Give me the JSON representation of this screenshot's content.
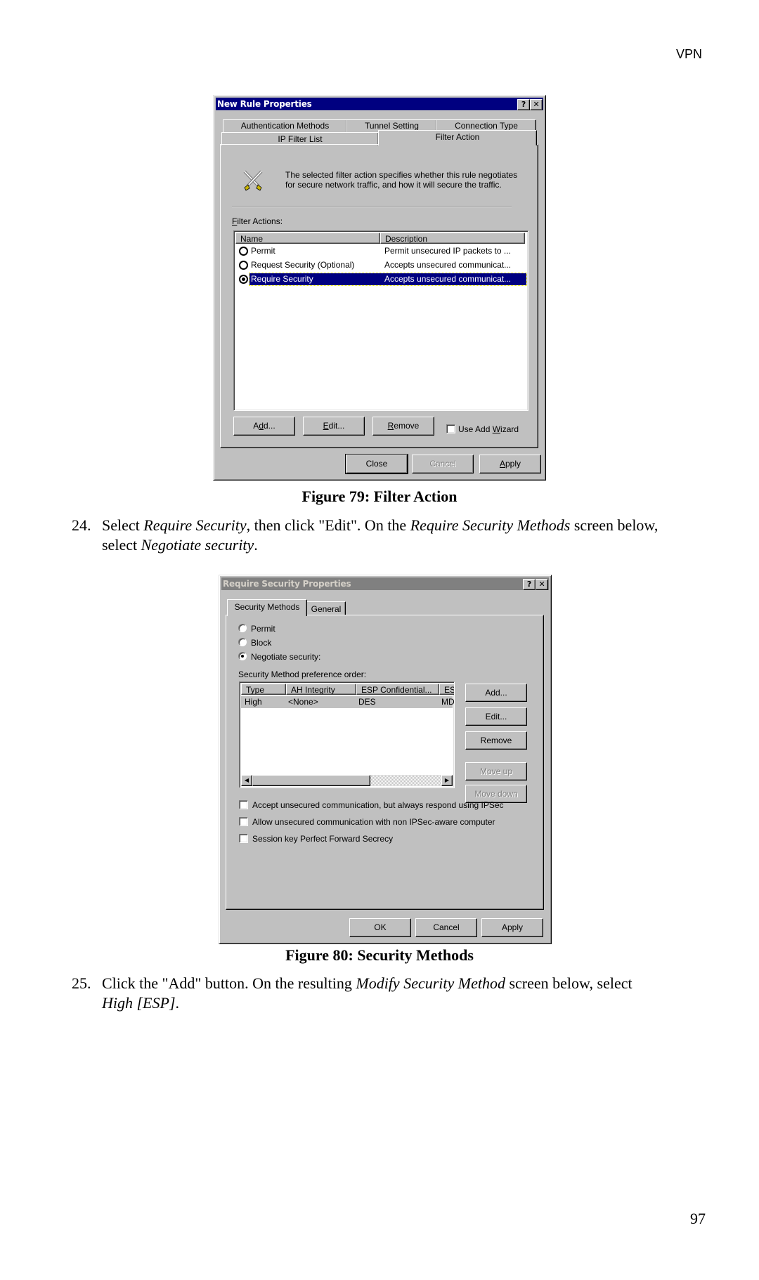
{
  "page": {
    "header": "VPN",
    "page_number": "97"
  },
  "figure79": {
    "caption": "Figure 79: Filter Action",
    "dialog": {
      "title": "New Rule Properties",
      "help_button": "?",
      "close_button": "✕",
      "tabs_back_row": [
        "Authentication Methods",
        "Tunnel Setting",
        "Connection Type"
      ],
      "tabs_front_row": [
        "IP Filter List",
        "Filter Action"
      ],
      "active_tab": "Filter Action",
      "description_line1": "The selected filter action specifies whether this rule negotiates",
      "description_line2": "for secure network traffic, and how it will secure the traffic.",
      "icon": "crossed-swords-icon",
      "list_label": "Filter Actions:",
      "columns": [
        "Name",
        "Description"
      ],
      "rows": [
        {
          "name": "Permit",
          "description": "Permit unsecured IP packets to ...",
          "selected": false
        },
        {
          "name": "Request Security (Optional)",
          "description": "Accepts unsecured communicat...",
          "selected": false
        },
        {
          "name": "Require Security",
          "description": "Accepts unsecured communicat...",
          "selected": true
        }
      ],
      "buttons": {
        "add": "Add...",
        "edit": "Edit...",
        "remove": "Remove"
      },
      "use_add_wizard": {
        "label": "Use Add Wizard",
        "checked": false
      },
      "footer": {
        "close": "Close",
        "cancel": "Cancel",
        "apply": "Apply"
      }
    }
  },
  "step24": {
    "number": "24.",
    "t1": "Select ",
    "i1": "Require Security",
    "t2": ", then click \"Edit\". On the ",
    "i2": "Require Security Methods",
    "t3": " screen below,",
    "t4": "select ",
    "i3": "Negotiate security",
    "t5": "."
  },
  "figure80": {
    "caption": "Figure 80: Security Methods",
    "dialog": {
      "title": "Require Security Properties",
      "help_button": "?",
      "close_button": "✕",
      "tabs": [
        "Security Methods",
        "General"
      ],
      "active_tab": "Security Methods",
      "radios": [
        {
          "label": "Permit",
          "checked": false
        },
        {
          "label": "Block",
          "checked": false
        },
        {
          "label": "Negotiate security:",
          "checked": true
        }
      ],
      "list_label": "Security Method preference order:",
      "columns": [
        "Type",
        "AH Integrity",
        "ESP Confidential...",
        "ES"
      ],
      "rows": [
        {
          "type": "High",
          "ah": "<None>",
          "esp_conf": "DES",
          "esp_int": "MD"
        }
      ],
      "side_buttons": {
        "add": "Add...",
        "edit": "Edit...",
        "remove": "Remove",
        "move_up": "Move up",
        "move_down": "Move down"
      },
      "checkboxes": [
        {
          "label": "Accept unsecured communication, but always respond using IPSec",
          "checked": false
        },
        {
          "label": "Allow unsecured communication with non IPSec-aware computer",
          "checked": false
        },
        {
          "label": "Session key Perfect Forward Secrecy",
          "checked": false
        }
      ],
      "footer": {
        "ok": "OK",
        "cancel": "Cancel",
        "apply": "Apply"
      }
    }
  },
  "step25": {
    "number": "25.",
    "t1": "Click the \"Add\" button. On the resulting ",
    "i1": "Modify Security Method",
    "t2": " screen below, select",
    "i2": "High [ESP]",
    "t3": "."
  }
}
